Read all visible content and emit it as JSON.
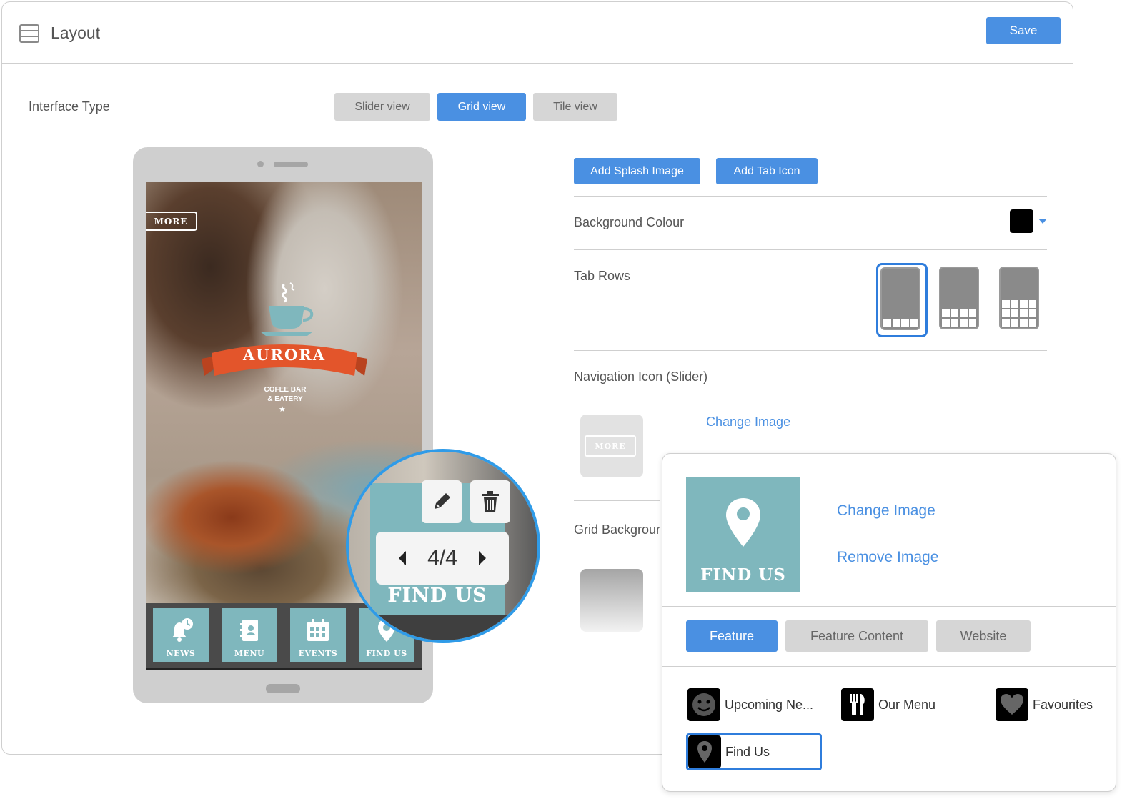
{
  "header": {
    "title": "Layout",
    "save_label": "Save"
  },
  "interface_type": {
    "label": "Interface Type",
    "options": [
      "Slider view",
      "Grid view",
      "Tile view"
    ],
    "selected": "Grid view"
  },
  "phone_preview": {
    "more_label": "MORE",
    "brand_name": "AURORA",
    "brand_sub_1": "COFEE BAR",
    "brand_sub_2": "& EATERY",
    "tabs": [
      "NEWS",
      "MENU",
      "EVENTS",
      "FIND US"
    ]
  },
  "zoom": {
    "pager": "4/4",
    "tile_label": "FIND US"
  },
  "settings": {
    "add_splash_label": "Add Splash Image",
    "add_tab_icon_label": "Add Tab Icon",
    "background_colour_label": "Background Colour",
    "background_colour": "#000000",
    "tab_rows_label": "Tab Rows",
    "tab_rows_selected": 1,
    "nav_icon_label": "Navigation Icon (Slider)",
    "nav_icon_more": "MORE",
    "nav_change_image": "Change Image",
    "grid_background_label": "Grid Backgrour"
  },
  "popup": {
    "tile_label": "FIND US",
    "change_image": "Change Image",
    "remove_image": "Remove Image",
    "tabs": [
      "Feature",
      "Feature Content",
      "Website"
    ],
    "selected_tab": "Feature",
    "features": [
      "Upcoming Ne...",
      "Our Menu",
      "Favourites",
      "Find Us"
    ],
    "selected_feature": "Find Us"
  },
  "colors": {
    "accent": "#4a90e2",
    "tile": "#7fb7bd",
    "ribbon": "#e3552b",
    "zoom_ring": "#2f9be8"
  }
}
